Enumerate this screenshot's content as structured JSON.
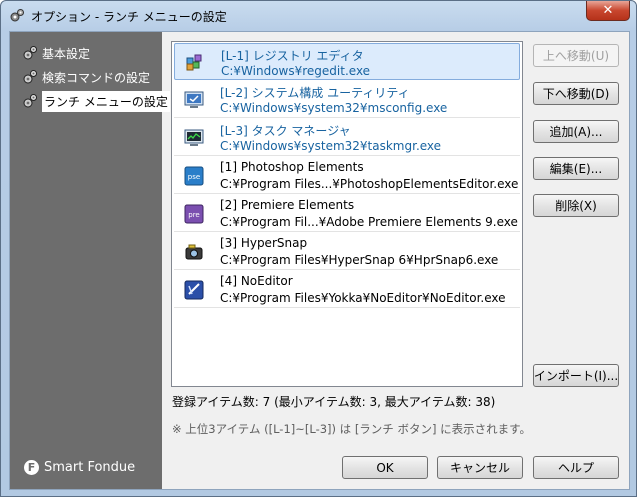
{
  "window": {
    "title": "オプション - ランチ メニューの設定",
    "close_label": "✕"
  },
  "sidebar": {
    "items": [
      {
        "label": "基本設定",
        "icon": "gears-icon"
      },
      {
        "label": "検索コマンドの設定",
        "icon": "gears-icon"
      },
      {
        "label": "ランチ メニューの設定",
        "icon": "gears-icon",
        "selected": true
      }
    ],
    "brand": {
      "logo_letter": "F",
      "name": "Smart Fondue"
    }
  },
  "launch_list": {
    "items": [
      {
        "name": "[L-1] レジストリ エディタ",
        "path": "C:¥Windows¥regedit.exe",
        "icon": "regedit-icon",
        "builtin": true,
        "selected": true
      },
      {
        "name": "[L-2] システム構成 ユーティリティ",
        "path": "C:¥Windows¥system32¥msconfig.exe",
        "icon": "msconfig-icon",
        "builtin": true
      },
      {
        "name": "[L-3] タスク マネージャ",
        "path": "C:¥Windows¥system32¥taskmgr.exe",
        "icon": "taskmgr-icon",
        "builtin": true
      },
      {
        "name": "[1] Photoshop Elements",
        "path": "C:¥Program Files...¥PhotoshopElementsEditor.exe",
        "icon": "photoshop-elements-icon",
        "icon_text": "pse"
      },
      {
        "name": "[2] Premiere Elements",
        "path": "C:¥Program Fil...¥Adobe Premiere Elements 9.exe",
        "icon": "premiere-elements-icon",
        "icon_text": "pre"
      },
      {
        "name": "[3] HyperSnap",
        "path": "C:¥Program Files¥HyperSnap 6¥HprSnap6.exe",
        "icon": "hypersnap-icon"
      },
      {
        "name": "[4] NoEditor",
        "path": "C:¥Program Files¥Yokka¥NoEditor¥NoEditor.exe",
        "icon": "noeditor-icon"
      }
    ]
  },
  "buttons": {
    "move_up": "上へ移動(U)",
    "move_down": "下へ移動(D)",
    "add": "追加(A)...",
    "edit": "編集(E)...",
    "delete": "削除(X)",
    "import": "インポート(I)...",
    "ok": "OK",
    "cancel": "キャンセル",
    "help": "ヘルプ"
  },
  "status": {
    "item_count": "登録アイテム数: 7 (最小アイテム数: 3, 最大アイテム数: 38)",
    "note": "※ 上位3アイテム ([L-1]~[L-3]) は [ランチ ボタン] に表示されます。"
  },
  "colors": {
    "sidebar_bg": "#6d6d6d",
    "link_text": "#1863a0",
    "selection_bg": "#dcebfc"
  }
}
